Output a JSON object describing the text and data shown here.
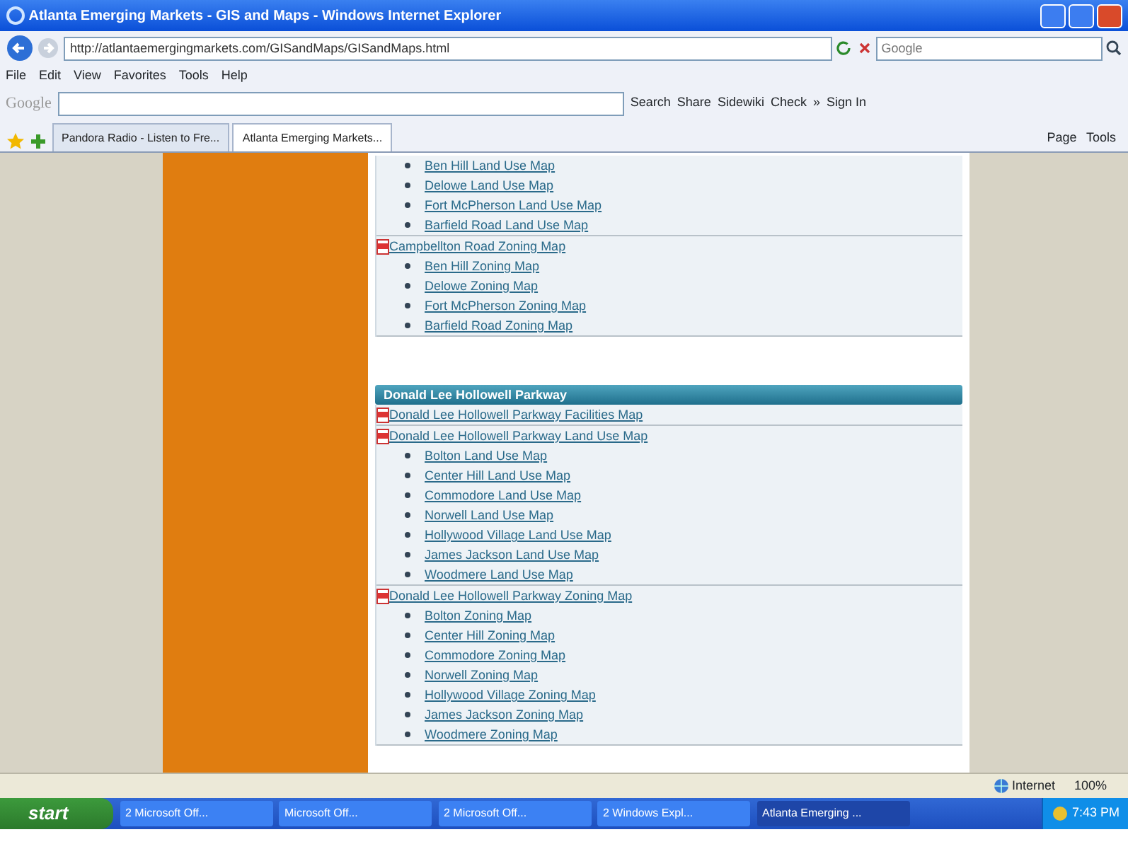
{
  "window": {
    "title": "Atlanta Emerging Markets - GIS and Maps - Windows Internet Explorer"
  },
  "address_bar": {
    "url": "http://atlantaemergingmarkets.com/GISandMaps/GISandMaps.html"
  },
  "search": {
    "placeholder": "Google"
  },
  "menu": [
    "File",
    "Edit",
    "View",
    "Favorites",
    "Tools",
    "Help"
  ],
  "google_toolbar": {
    "logo": "Google",
    "buttons": [
      "Search",
      "Share",
      "Sidewiki",
      "Check",
      "»",
      "Sign In"
    ]
  },
  "tabs": [
    {
      "label": "Pandora Radio - Listen to Fre...",
      "selected": false
    },
    {
      "label": "Atlanta Emerging Markets...",
      "selected": true
    }
  ],
  "command_bar": [
    "Page",
    "Tools"
  ],
  "page": {
    "sections": [
      {
        "continued_links": [
          "Ben Hill Land Use Map",
          "Delowe Land Use Map",
          "Fort McPherson Land Use Map",
          "Barfield Road Land Use Map"
        ],
        "groups": [
          {
            "label": "Campbellton Road Zoning Map",
            "links": [
              "Ben Hill Zoning Map",
              "Delowe Zoning Map",
              "Fort McPherson Zoning Map",
              "Barfield Road Zoning Map"
            ]
          }
        ]
      },
      {
        "heading": "Donald Lee Hollowell Parkway",
        "groups": [
          {
            "label": "Donald Lee Hollowell Parkway Facilities Map"
          },
          {
            "label": "Donald Lee Hollowell Parkway Land Use Map",
            "links": [
              "Bolton Land Use Map",
              "Center Hill Land Use Map",
              "Commodore Land Use Map",
              "Norwell Land Use Map",
              "Hollywood Village Land Use Map",
              "James Jackson Land Use Map",
              "Woodmere Land Use Map"
            ]
          },
          {
            "label": "Donald Lee Hollowell Parkway Zoning Map",
            "links": [
              "Bolton Zoning Map",
              "Center Hill Zoning Map",
              "Commodore Zoning Map",
              "Norwell Zoning Map",
              "Hollywood Village Zoning Map",
              "James Jackson Zoning Map",
              "Woodmere Zoning Map"
            ]
          }
        ]
      }
    ]
  },
  "status_bar": {
    "zone": "Internet",
    "zoom": "100%"
  },
  "taskbar": {
    "start": "start",
    "tasks": [
      {
        "label": "2 Microsoft Off...",
        "selected": false
      },
      {
        "label": "Microsoft Off...",
        "selected": false
      },
      {
        "label": "2 Microsoft Off...",
        "selected": false
      },
      {
        "label": "2 Windows Expl...",
        "selected": false
      },
      {
        "label": "Atlanta Emerging ...",
        "selected": true
      }
    ],
    "clock": "7:43 PM"
  }
}
